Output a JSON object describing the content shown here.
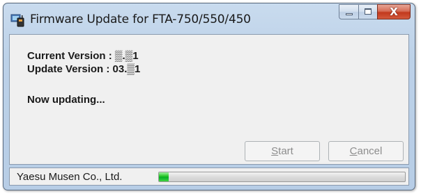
{
  "window": {
    "title": "Firmware Update for FTA-750/550/450",
    "app_icon": "radio-device-icon",
    "caption_icons": {
      "minimize": "minimize-icon",
      "maximize": "maximize-icon",
      "close": "close-icon",
      "close_glyph": "X"
    }
  },
  "info": {
    "current_version": "Current Version : ▒.▒1",
    "update_version": "Update Version : 03.▒1",
    "status": "Now updating..."
  },
  "buttons": {
    "start": {
      "label_pre": "",
      "label_ul": "S",
      "label_post": "tart",
      "enabled": false
    },
    "cancel": {
      "label_pre": "",
      "label_ul": "C",
      "label_post": "ancel",
      "enabled": false
    }
  },
  "statusbar": {
    "company": "Yaesu Musen Co., Ltd.",
    "progress_fraction": 0.04
  },
  "colors": {
    "progress_fill": "#06b025",
    "close_button": "#c2391d",
    "disabled_text": "#8d8d8d"
  }
}
